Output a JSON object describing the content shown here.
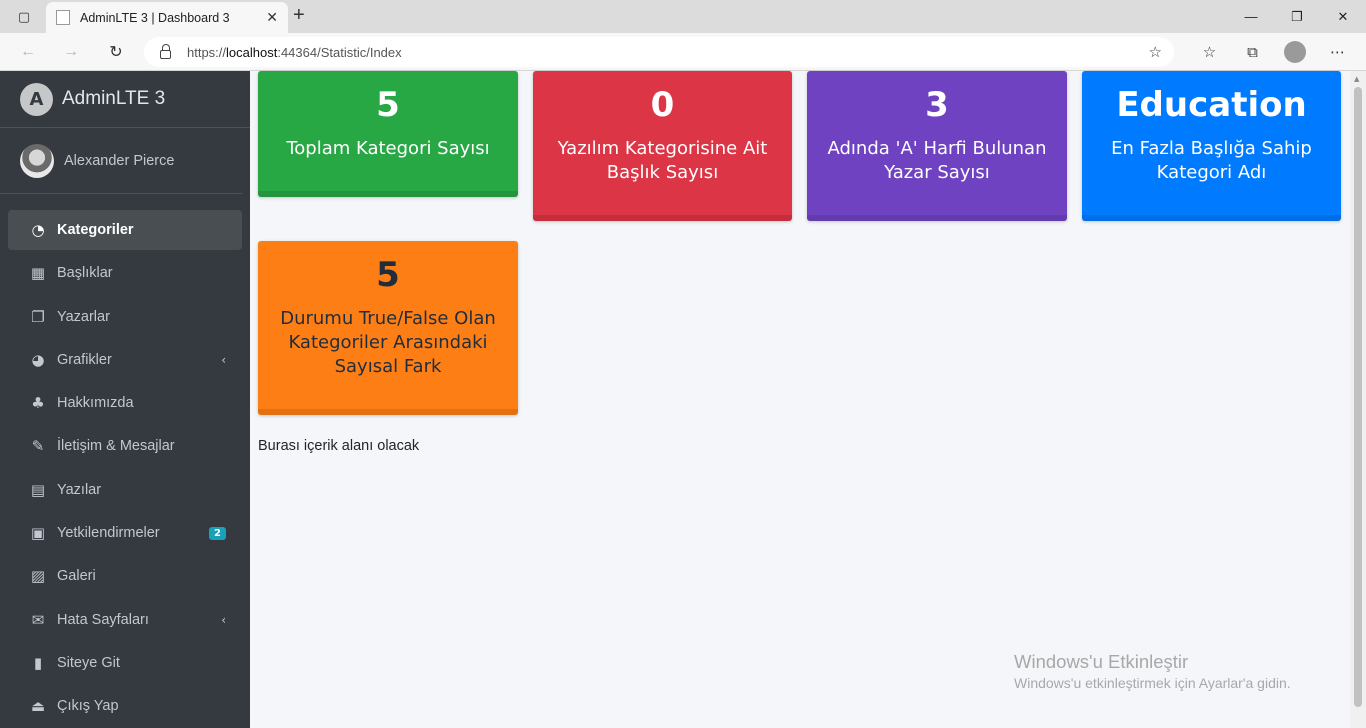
{
  "browser": {
    "tab_title": "AdminLTE 3 | Dashboard 3",
    "tab_close": "✕",
    "new_tab": "+",
    "url_prefix": "https://",
    "url_host": "localhost",
    "url_rest": ":44364/Statistic/Index",
    "window_controls": [
      "—",
      "❐",
      "✕"
    ]
  },
  "sidebar": {
    "brand": "AdminLTE 3",
    "brand_logo_letter": "A",
    "user_name": "Alexander Pierce",
    "items": [
      {
        "label": "Kategoriler",
        "icon": "dashboard-icon",
        "active": true
      },
      {
        "label": "Başlıklar",
        "icon": "grid-icon"
      },
      {
        "label": "Yazarlar",
        "icon": "copy-icon"
      },
      {
        "label": "Grafikler",
        "icon": "pie-chart-icon",
        "arrow": "‹"
      },
      {
        "label": "Hakkımızda",
        "icon": "tree-icon"
      },
      {
        "label": "İletişim & Mesajlar",
        "icon": "edit-icon"
      },
      {
        "label": "Yazılar",
        "icon": "table-icon"
      },
      {
        "label": "Yetkilendirmeler",
        "icon": "calendar-icon",
        "badge": "2"
      },
      {
        "label": "Galeri",
        "icon": "image-icon"
      },
      {
        "label": "Hata Sayfaları",
        "icon": "envelope-icon",
        "arrow": "‹"
      },
      {
        "label": "Siteye Git",
        "icon": "book-icon"
      },
      {
        "label": "Çıkış Yap",
        "icon": "logout-icon"
      }
    ]
  },
  "stats": [
    {
      "value": "5",
      "label": "Toplam Kategori Sayısı",
      "color": "#28a745"
    },
    {
      "value": "0",
      "label": "Yazılım Kategorisine Ait Başlık Sayısı",
      "color": "#dc3545"
    },
    {
      "value": "3",
      "label": "Adında 'A' Harfi Bulunan Yazar Sayısı",
      "color": "#6f42c1"
    },
    {
      "value": "Education",
      "label": "En Fazla Başlığa Sahip Kategori Adı",
      "color": "#007bff"
    },
    {
      "value": "5",
      "label": "Durumu True/False Olan Kategoriler Arasındaki Sayısal Fark",
      "color": "#fd7e14"
    }
  ],
  "content_text": "Burası içerik alanı olacak",
  "watermark": {
    "title": "Windows'u Etkinleştir",
    "subtitle": "Windows'u etkinleştirmek için Ayarlar'a gidin."
  }
}
